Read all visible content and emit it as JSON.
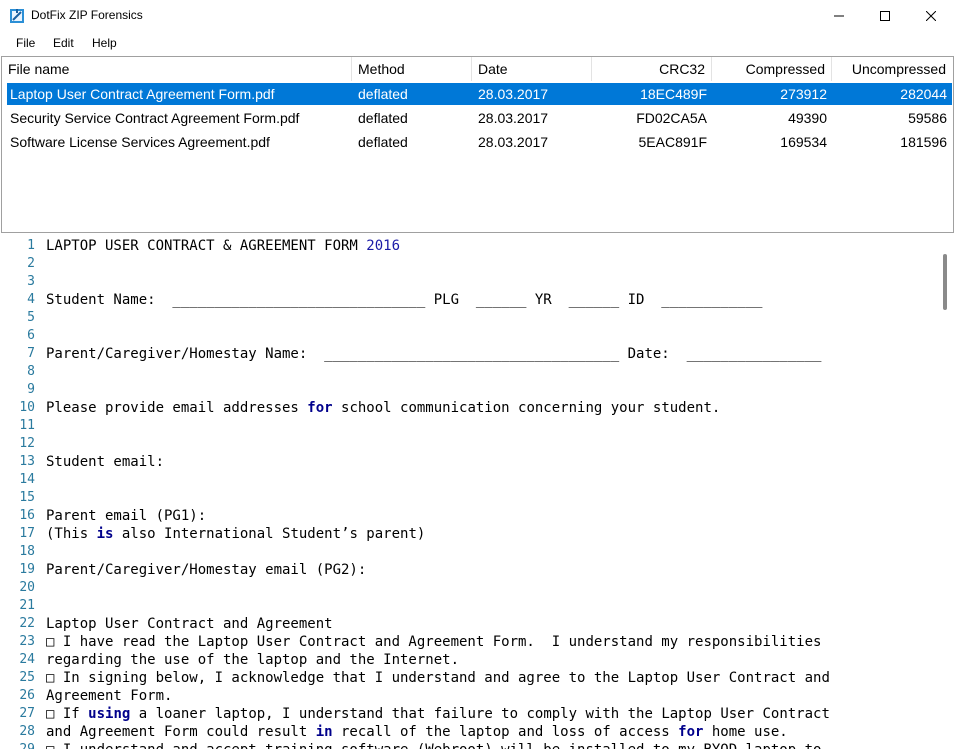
{
  "window": {
    "title": "DotFix ZIP Forensics",
    "icon": "zip-app-icon"
  },
  "menu": {
    "items": [
      "File",
      "Edit",
      "Help"
    ]
  },
  "filelist": {
    "columns": [
      "File name",
      "Method",
      "Date",
      "CRC32",
      "Compressed",
      "Uncompressed"
    ],
    "rows": [
      {
        "name": "Laptop User Contract Agreement Form.pdf",
        "method": "deflated",
        "date": "28.03.2017",
        "crc": "18EC489F",
        "compressed": "273912",
        "uncompressed": "282044",
        "selected": true
      },
      {
        "name": "Security Service Contract Agreement Form.pdf",
        "method": "deflated",
        "date": "28.03.2017",
        "crc": "FD02CA5A",
        "compressed": "49390",
        "uncompressed": "59586",
        "selected": false
      },
      {
        "name": "Software License Services Agreement.pdf",
        "method": "deflated",
        "date": "28.03.2017",
        "crc": "5EAC891F",
        "compressed": "169534",
        "uncompressed": "181596",
        "selected": false
      }
    ]
  },
  "editor": {
    "lines": [
      [
        {
          "t": "LAPTOP USER CONTRACT & AGREEMENT FORM "
        },
        {
          "t": "2016",
          "c": "num"
        }
      ],
      [],
      [],
      [
        {
          "t": "Student Name:  ______________________________ PLG  ______ YR  ______ ID  ____________"
        }
      ],
      [],
      [],
      [
        {
          "t": "Parent/Caregiver/Homestay Name:  ___________________________________ Date:  ________________"
        }
      ],
      [],
      [],
      [
        {
          "t": "Please provide email addresses "
        },
        {
          "t": "for",
          "c": "kw"
        },
        {
          "t": " school communication concerning your student."
        }
      ],
      [],
      [],
      [
        {
          "t": "Student email:"
        }
      ],
      [],
      [],
      [
        {
          "t": "Parent email (PG1):"
        }
      ],
      [
        {
          "t": "(This "
        },
        {
          "t": "is",
          "c": "kw"
        },
        {
          "t": " also International Student’s parent)"
        }
      ],
      [],
      [
        {
          "t": "Parent/Caregiver/Homestay email (PG2):"
        }
      ],
      [],
      [],
      [
        {
          "t": "Laptop User Contract and Agreement"
        }
      ],
      [
        {
          "t": "□ I have read the Laptop User Contract and Agreement Form.  I understand my responsibilities"
        }
      ],
      [
        {
          "t": "regarding the use of the laptop and the Internet."
        }
      ],
      [
        {
          "t": "□ In signing below, I acknowledge that I understand and agree to the Laptop User Contract and"
        }
      ],
      [
        {
          "t": "Agreement Form."
        }
      ],
      [
        {
          "t": "□ If "
        },
        {
          "t": "using",
          "c": "kw"
        },
        {
          "t": " a loaner laptop, I understand that failure to comply with the Laptop User Contract"
        }
      ],
      [
        {
          "t": "and Agreement Form could result "
        },
        {
          "t": "in",
          "c": "kw"
        },
        {
          "t": " recall of the laptop and loss of access "
        },
        {
          "t": "for",
          "c": "kw"
        },
        {
          "t": " home use."
        }
      ],
      [
        {
          "t": "□ I understand and accept training software (Webroot) will be installed to my BYOD laptop to"
        }
      ]
    ]
  }
}
